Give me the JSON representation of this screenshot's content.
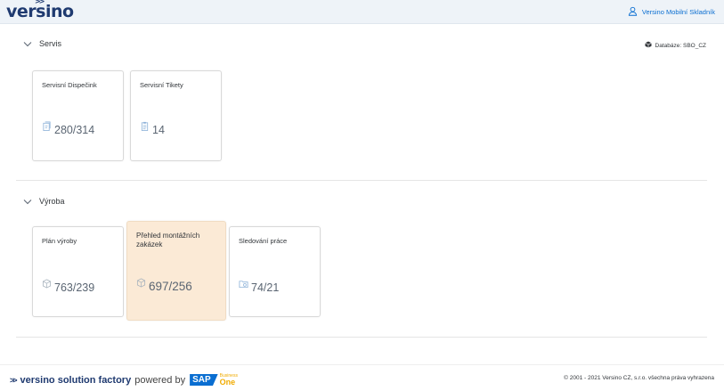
{
  "header": {
    "logo_text": "versino",
    "user_name": "Versino Mobilní Skladník"
  },
  "sections": [
    {
      "title": "Servis",
      "database": "Databáze: SBO_CZ",
      "tiles": [
        {
          "title": "Servisní Dispečink",
          "value": "280/314",
          "icon": "document-icon"
        },
        {
          "title": "Servisní Tikety",
          "value": "14",
          "icon": "clipboard-icon"
        }
      ]
    },
    {
      "title": "Výroba",
      "tiles": [
        {
          "title": "Plán výroby",
          "value": "763/239",
          "icon": "cube-icon"
        },
        {
          "title": "Přehled montážních zakázek",
          "value": "697/256",
          "icon": "cube-icon"
        },
        {
          "title": "Sledování práce",
          "value": "74/21",
          "icon": "folder-icon"
        }
      ]
    }
  ],
  "footer": {
    "brand_bold": "versino solution factory",
    "powered_by": "powered by",
    "sap": "SAP",
    "sap_business": "Business",
    "sap_one": "One",
    "copyright": "© 2001 - 2021 Versino CZ, s.r.o. všechna práva vyhrazena"
  },
  "colors": {
    "header_bg": "#eef3f8",
    "brand": "#1f3a70",
    "link": "#0a6ed1",
    "highlight_tile": "#fbead6"
  }
}
